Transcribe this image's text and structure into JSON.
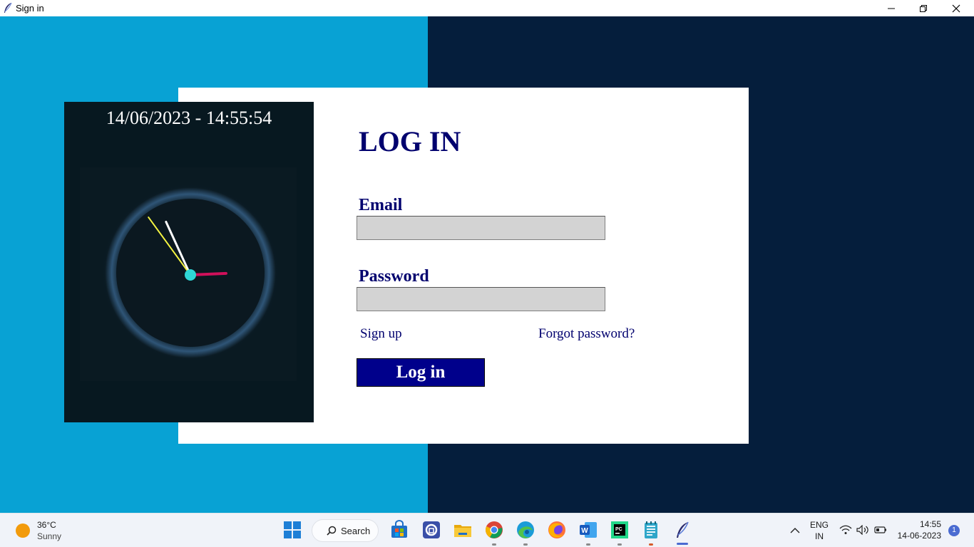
{
  "window": {
    "title": "Sign in"
  },
  "clock": {
    "datetime": "14/06/2023 - 14:55:54",
    "hour": 14,
    "minute": 55,
    "second": 54
  },
  "login": {
    "heading": "LOG IN",
    "email_label": "Email",
    "email_value": "",
    "password_label": "Password",
    "password_value": "",
    "signup_link": "Sign up",
    "forgot_link": "Forgot password?",
    "login_button": "Log in"
  },
  "taskbar": {
    "weather_temp": "36°C",
    "weather_condition": "Sunny",
    "search_label": "Search",
    "language_line1": "ENG",
    "language_line2": "IN",
    "time": "14:55",
    "date": "14-06-2023",
    "notification_count": "1",
    "pinned_apps": [
      "start-icon",
      "search",
      "store-icon",
      "app-icon",
      "file-explorer-icon",
      "chrome-icon",
      "edge-icon",
      "firefox-icon",
      "word-icon",
      "pycharm-icon",
      "notepad-icon",
      "feather-app-icon"
    ]
  },
  "colors": {
    "bg_left": "#08a2d4",
    "bg_right": "#051e3c",
    "accent_navy": "#00006e",
    "button_blue": "#00008b",
    "input_gray": "#d3d3d3",
    "clock_panel": "#071820",
    "hour_hand": "#d0105a",
    "minute_hand": "#ffffff",
    "second_hand": "#f5f542",
    "center_dot": "#2ed6d6"
  }
}
